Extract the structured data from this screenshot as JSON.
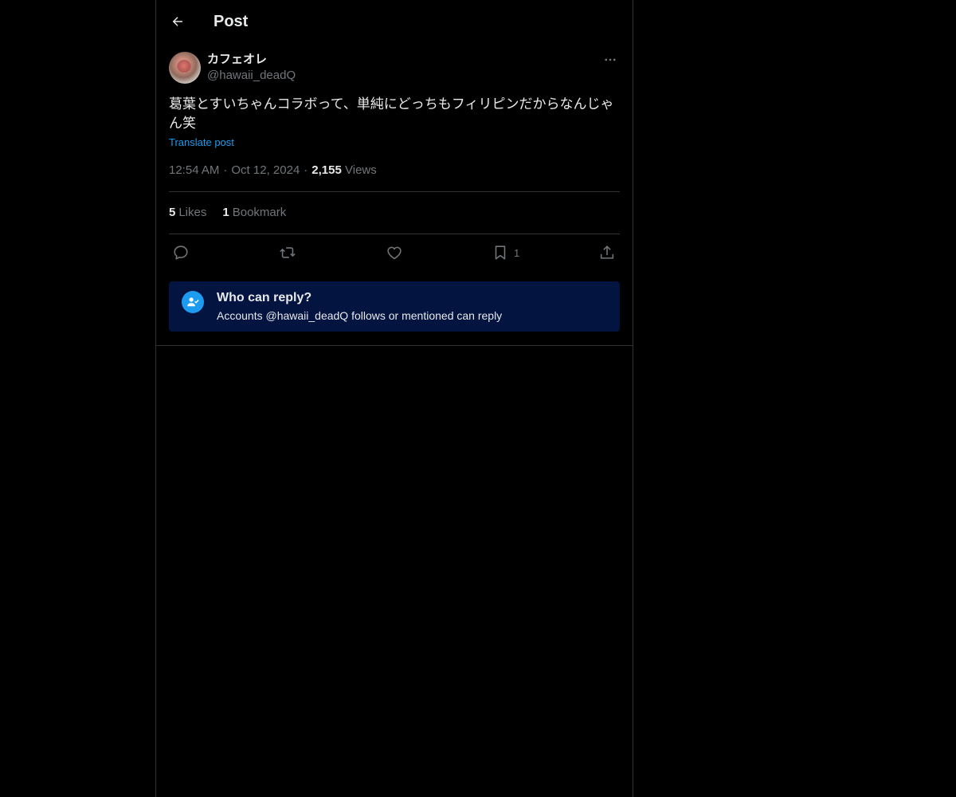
{
  "header": {
    "title": "Post"
  },
  "post": {
    "author": {
      "display_name": "カフェオレ",
      "handle": "@hawaii_deadQ"
    },
    "text": "葛葉とすいちゃんコラボって、単純にどっちもフィリピンだからなんじゃん笑",
    "translate_label": "Translate post",
    "time": "12:54 AM",
    "date": "Oct 12, 2024",
    "separator": "·",
    "views_count": "2,155",
    "views_label": "Views",
    "likes_count": "5",
    "likes_label": "Likes",
    "bookmarks_count": "1",
    "bookmarks_label": "Bookmark"
  },
  "actions": {
    "bookmark_count": "1"
  },
  "reply_settings": {
    "title": "Who can reply?",
    "subtitle": "Accounts @hawaii_deadQ follows or mentioned can reply"
  },
  "colors": {
    "background": "#000000",
    "text": "#e7e9ea",
    "secondary": "#71767b",
    "accent": "#1d9bf0",
    "border": "#2f3336",
    "reply_box": "#031441"
  },
  "icons": {
    "back": "arrow-left-icon",
    "more": "more-horizontal-icon",
    "reply": "speech-bubble-icon",
    "repost": "repost-icon",
    "like": "heart-icon",
    "bookmark": "bookmark-icon",
    "share": "share-icon",
    "reply_settings": "user-check-icon"
  }
}
